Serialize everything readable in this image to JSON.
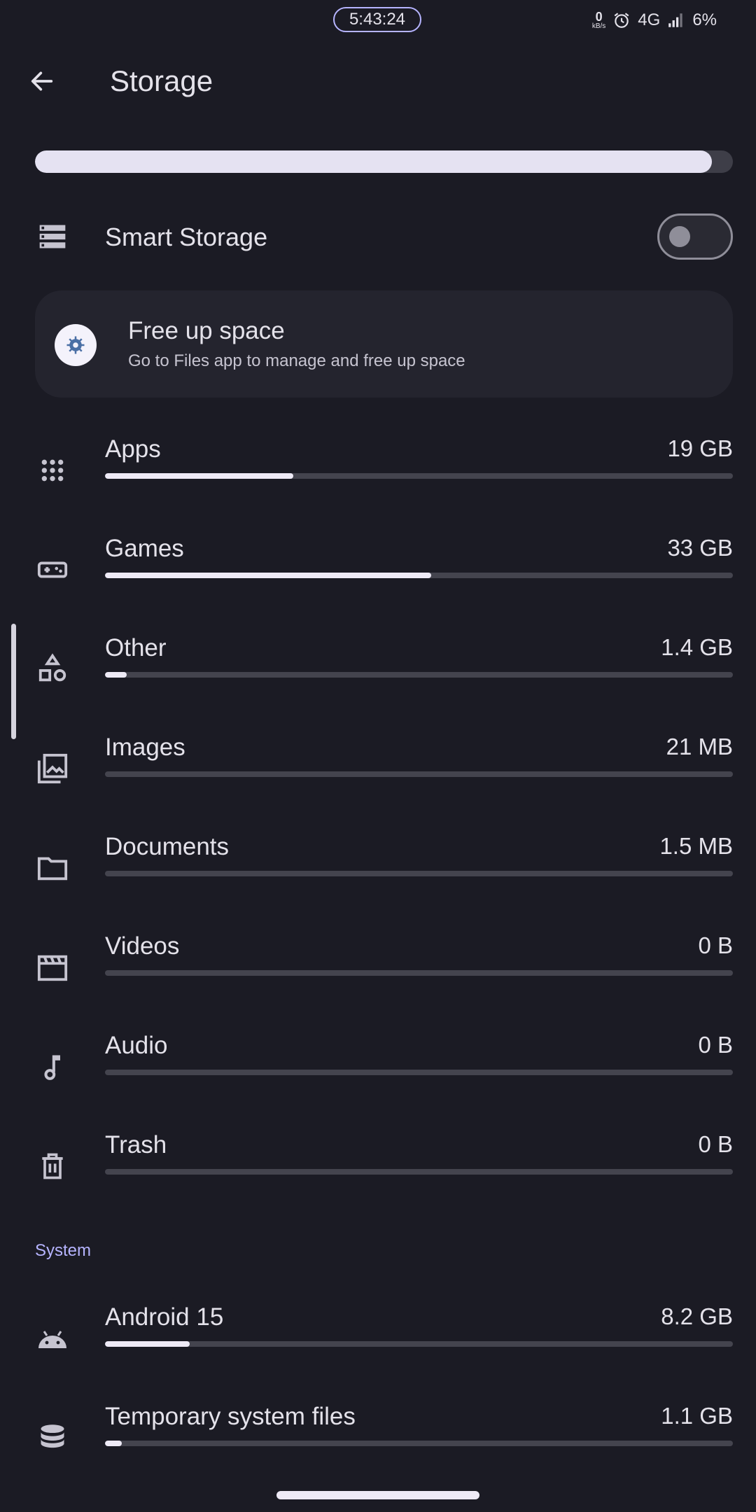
{
  "status_bar": {
    "time": "5:43:24",
    "net_speed_value": "0",
    "net_speed_unit": "kB/s",
    "network": "4G",
    "battery": "6%"
  },
  "header": {
    "title": "Storage"
  },
  "total_usage": {
    "used_fraction": 0.97
  },
  "smart_storage": {
    "label": "Smart Storage",
    "enabled": false
  },
  "free_up": {
    "title": "Free up space",
    "subtitle": "Go to Files app to manage and free up space"
  },
  "categories": [
    {
      "label": "Apps",
      "value": "19 GB",
      "fraction": 0.3,
      "icon": "apps-grid-icon"
    },
    {
      "label": "Games",
      "value": "33 GB",
      "fraction": 0.52,
      "icon": "gamepad-icon"
    },
    {
      "label": "Other",
      "value": "1.4 GB",
      "fraction": 0.035,
      "icon": "shapes-icon"
    },
    {
      "label": "Images",
      "value": "21 MB",
      "fraction": 0.0,
      "icon": "images-icon"
    },
    {
      "label": "Documents",
      "value": "1.5 MB",
      "fraction": 0.0,
      "icon": "folder-icon"
    },
    {
      "label": "Videos",
      "value": "0 B",
      "fraction": 0.0,
      "icon": "movie-icon"
    },
    {
      "label": "Audio",
      "value": "0 B",
      "fraction": 0.0,
      "icon": "music-note-icon"
    },
    {
      "label": "Trash",
      "value": "0 B",
      "fraction": 0.0,
      "icon": "trash-icon"
    }
  ],
  "system": {
    "header": "System",
    "items": [
      {
        "label": "Android 15",
        "value": "8.2 GB",
        "fraction": 0.135,
        "icon": "android-icon"
      },
      {
        "label": "Temporary system files",
        "value": "1.1 GB",
        "fraction": 0.027,
        "icon": "database-icon"
      }
    ]
  },
  "colors": {
    "background": "#1b1b24",
    "accent": "#b6b4ff",
    "bar_fill": "#eeeaf6",
    "bar_track": "#44444e"
  }
}
